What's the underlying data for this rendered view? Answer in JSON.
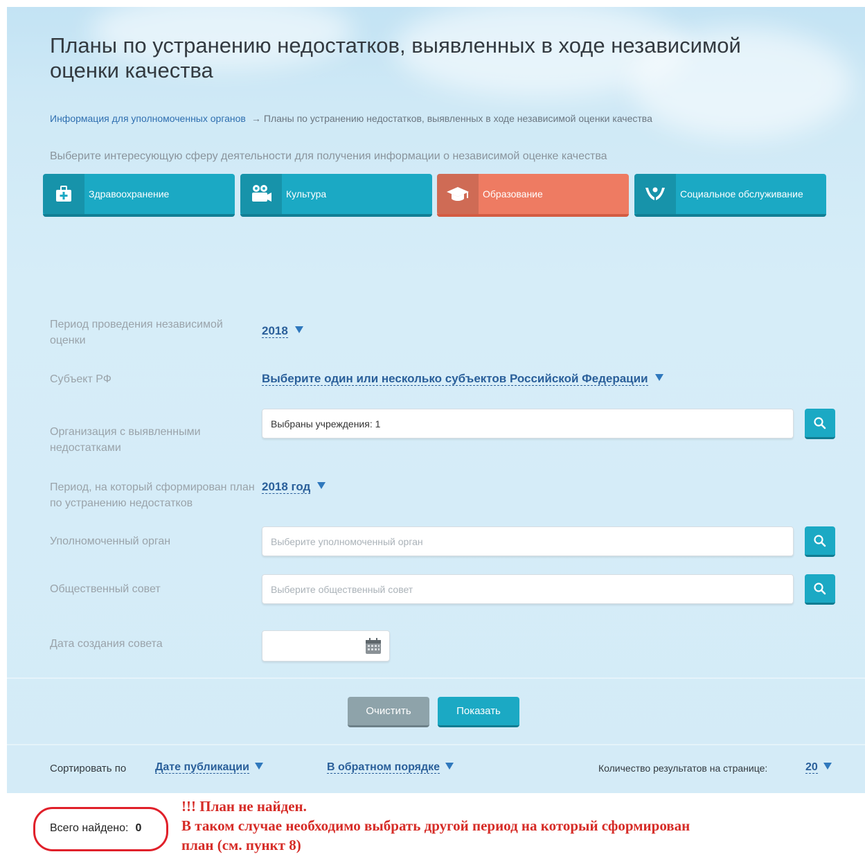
{
  "page": {
    "title": "Планы по устранению недостатков, выявленных в ходе независимой оценки качества"
  },
  "breadcrumb": {
    "link": "Информация для уполномоченных органов",
    "arrow": "→",
    "current": "Планы по устранению недостатков, выявленных в ходе независимой оценки качества"
  },
  "hint": "Выберите интересующую сферу деятельности для получения информации о независимой оценке качества",
  "spheres": [
    {
      "label": "Здравоохранение",
      "icon": "medical-kit-icon",
      "active": false
    },
    {
      "label": "Культура",
      "icon": "film-camera-icon",
      "active": false
    },
    {
      "label": "Образование",
      "icon": "graduation-cap-icon",
      "active": true
    },
    {
      "label": "Социальное обслуживание",
      "icon": "helping-hands-icon",
      "active": false
    }
  ],
  "filters": {
    "period": {
      "label": "Период проведения независимой оценки",
      "value": "2018"
    },
    "subject": {
      "label": "Субъект РФ",
      "value": "Выберите один или несколько субъектов Российской Федерации"
    },
    "organization": {
      "label": "Организация с выявленными недостатками",
      "value": "Выбраны учреждения: 1"
    },
    "plan_period": {
      "label": "Период, на который сформирован план по устранению недостатков",
      "value": "2018 год"
    },
    "authority": {
      "label": "Уполномоченный орган",
      "placeholder": "Выберите уполномоченный орган"
    },
    "council": {
      "label": "Общественный совет",
      "placeholder": "Выберите общественный совет"
    },
    "council_date": {
      "label": "Дата создания совета",
      "value": ""
    }
  },
  "actions": {
    "clear": "Очистить",
    "show": "Показать"
  },
  "sort": {
    "label": "Сортировать по",
    "field": "Дате публикации",
    "order": "В обратном порядке",
    "per_page_label": "Количество результатов на странице:",
    "per_page": "20"
  },
  "results": {
    "total_label": "Всего найдено:",
    "total": "0"
  },
  "annotation": {
    "line1": "!!! План не найден.",
    "line2": "В таком случае необходимо выбрать другой период на который сформирован план (см. пункт 8)"
  },
  "colors": {
    "accent": "#1ba9c4",
    "active_sphere": "#ee7b62",
    "link": "#2a5f9a",
    "annotation": "#d62c27"
  }
}
